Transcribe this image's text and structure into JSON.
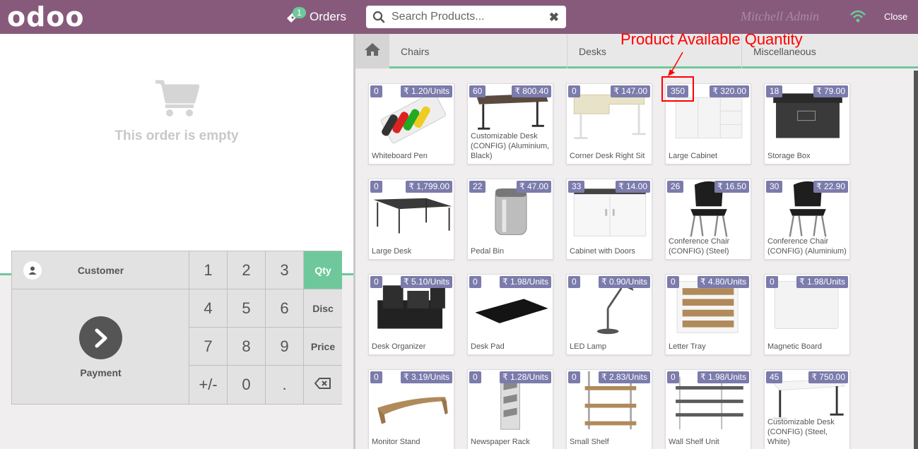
{
  "header": {
    "logo": "odoo",
    "orders_count": "1",
    "orders_label": "Orders",
    "search_placeholder": "Search Products...",
    "clear_icon": "times-icon",
    "user": "Mitchell Admin",
    "close_label": "Close",
    "wifi_color": "#6ec89b"
  },
  "order": {
    "empty_text": "This order is empty"
  },
  "numpad": {
    "customer_label": "Customer",
    "payment_label": "Payment",
    "keys": [
      "1",
      "2",
      "3",
      "4",
      "5",
      "6",
      "7",
      "8",
      "9",
      "+/-",
      "0",
      "."
    ],
    "modes": [
      "Qty",
      "Disc",
      "Price"
    ],
    "active_mode": "Qty",
    "accent": "#6ec89b"
  },
  "categories": [
    "Chairs",
    "Desks",
    "Miscellaneous"
  ],
  "annotation": {
    "text": "Product Available Quantity",
    "color": "#ff0000"
  },
  "products": [
    {
      "qty": "0",
      "price": "₹ 1.20/Units",
      "name": "Whiteboard Pen",
      "art": "pens"
    },
    {
      "qty": "60",
      "price": "₹ 800.40",
      "name": "Customizable Desk (CONFIG) (Aluminium, Black)",
      "art": "desk-dark"
    },
    {
      "qty": "0",
      "price": "₹ 147.00",
      "name": "Corner Desk Right Sit",
      "art": "desk-light"
    },
    {
      "qty": "350",
      "price": "₹ 320.00",
      "name": "Large Cabinet",
      "art": "cabinet"
    },
    {
      "qty": "18",
      "price": "₹ 79.00",
      "name": "Storage Box",
      "art": "box"
    },
    {
      "qty": "0",
      "price": "₹ 1,799.00",
      "name": "Large Desk",
      "art": "large-desk"
    },
    {
      "qty": "22",
      "price": "₹ 47.00",
      "name": "Pedal Bin",
      "art": "bin"
    },
    {
      "qty": "33",
      "price": "₹ 14.00",
      "name": "Cabinet with Doors",
      "art": "cabinet-doors"
    },
    {
      "qty": "26",
      "price": "₹ 16.50",
      "name": "Conference Chair (CONFIG) (Steel)",
      "art": "chair"
    },
    {
      "qty": "30",
      "price": "₹ 22.90",
      "name": "Conference Chair (CONFIG) (Aluminium)",
      "art": "chair"
    },
    {
      "qty": "0",
      "price": "₹ 5.10/Units",
      "name": "Desk Organizer",
      "art": "organizer"
    },
    {
      "qty": "0",
      "price": "₹ 1.98/Units",
      "name": "Desk Pad",
      "art": "pad"
    },
    {
      "qty": "0",
      "price": "₹ 0.90/Units",
      "name": "LED Lamp",
      "art": "lamp"
    },
    {
      "qty": "0",
      "price": "₹ 4.80/Units",
      "name": "Letter Tray",
      "art": "tray"
    },
    {
      "qty": "0",
      "price": "₹ 1.98/Units",
      "name": "Magnetic Board",
      "art": "board"
    },
    {
      "qty": "0",
      "price": "₹ 3.19/Units",
      "name": "Monitor Stand",
      "art": "stand"
    },
    {
      "qty": "0",
      "price": "₹ 1.28/Units",
      "name": "Newspaper Rack",
      "art": "rack"
    },
    {
      "qty": "0",
      "price": "₹ 2.83/Units",
      "name": "Small Shelf",
      "art": "small-shelf"
    },
    {
      "qty": "0",
      "price": "₹ 1.98/Units",
      "name": "Wall Shelf Unit",
      "art": "wall-shelf"
    },
    {
      "qty": "45",
      "price": "₹ 750.00",
      "name": "Customizable Desk (CONFIG) (Steel, White)",
      "art": "desk-white"
    }
  ]
}
